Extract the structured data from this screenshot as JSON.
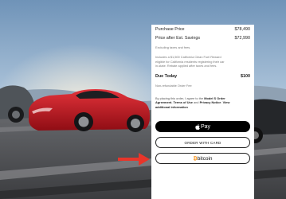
{
  "summary": {
    "purchase_label": "Purchase Price",
    "purchase_value": "$78,490",
    "savings_label": "Price after Est. Savings",
    "savings_value": "$72,990",
    "excl_note": "Excluding taxes and fees.",
    "rebate_lines": [
      "Includes a $1,500 California Clean Fuel Reward",
      "eligible for California residents registering their car",
      "in-state. Rebate applied after taxes and fees."
    ],
    "due_label": "Due Today",
    "due_value": "$100",
    "fee_note": "Non-refundable Order Fee"
  },
  "legal": {
    "line1": "By placing this order, I agree to the",
    "model_link": "Model S Order",
    "agreement": "Agreement",
    "terms": "Terms of Use",
    "and": "and",
    "privacy": "Privacy Notice",
    "view": "View",
    "additional": "additional information"
  },
  "buttons": {
    "apple_pay": "Pay",
    "order_card": "ORDER WITH CARD",
    "bitcoin_b": "₿",
    "bitcoin": "bitcoin"
  },
  "colors": {
    "car": "#c8171f",
    "bitcoin": "#f7931a",
    "arrow": "#e8352a"
  },
  "icons": [
    "apple-icon",
    "bitcoin-icon",
    "arrow-icon"
  ]
}
